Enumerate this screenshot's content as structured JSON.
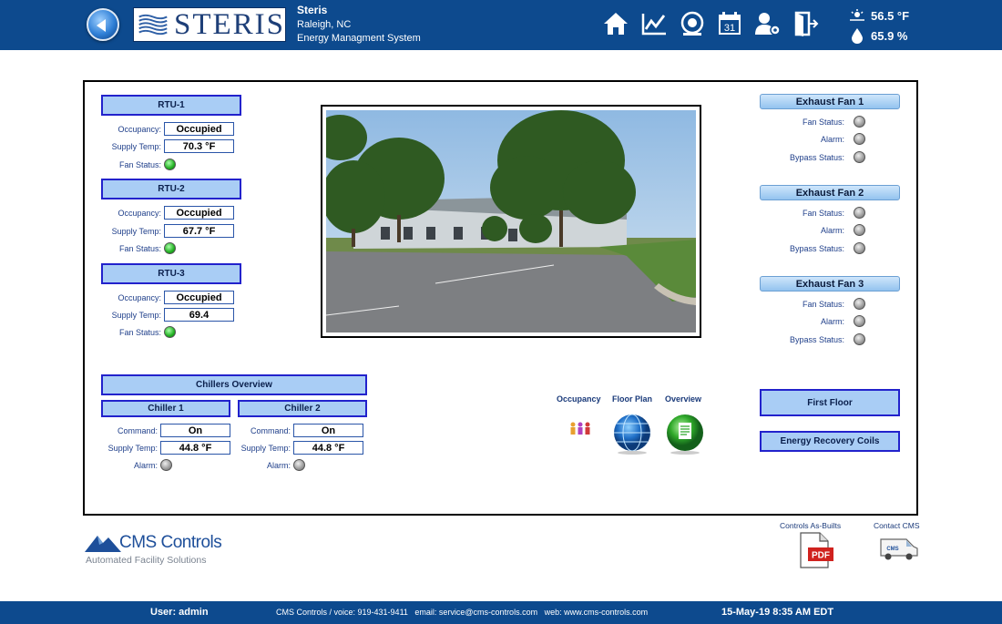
{
  "header": {
    "logo_text": "STERIS",
    "site_name": "Steris",
    "site_location": "Raleigh, NC",
    "site_system": "Energy Managment System",
    "nav_icons": [
      "home-icon",
      "trend-chart-icon",
      "alarm-bell-icon",
      "calendar-icon",
      "user-settings-icon",
      "logout-icon"
    ],
    "calendar_day": "31",
    "outdoor_temp": "56.5 °F",
    "outdoor_humidity": "65.9 %"
  },
  "rtus": [
    {
      "title": "RTU-1",
      "occupancy_label": "Occupancy:",
      "occupancy": "Occupied",
      "supply_label": "Supply Temp:",
      "supply_temp": "70.3 °F",
      "fan_label": "Fan Status:",
      "fan_status": "on"
    },
    {
      "title": "RTU-2",
      "occupancy_label": "Occupancy:",
      "occupancy": "Occupied",
      "supply_label": "Supply Temp:",
      "supply_temp": "67.7 °F",
      "fan_label": "Fan Status:",
      "fan_status": "on"
    },
    {
      "title": "RTU-3",
      "occupancy_label": "Occupancy:",
      "occupancy": "Occupied",
      "supply_label": "Supply Temp:",
      "supply_temp": "69.4",
      "fan_label": "Fan Status:",
      "fan_status": "on"
    }
  ],
  "exhaust_fans": [
    {
      "title": "Exhaust Fan 1",
      "fan_status_label": "Fan Status:",
      "alarm_label": "Alarm:",
      "bypass_label": "Bypass Status:"
    },
    {
      "title": "Exhaust Fan 2",
      "fan_status_label": "Fan Status:",
      "alarm_label": "Alarm:",
      "bypass_label": "Bypass Status:"
    },
    {
      "title": "Exhaust Fan 3",
      "fan_status_label": "Fan Status:",
      "alarm_label": "Alarm:",
      "bypass_label": "Bypass Status:"
    }
  ],
  "chillers": {
    "overview_title": "Chillers Overview",
    "units": [
      {
        "title": "Chiller 1",
        "command_label": "Command:",
        "command": "On",
        "supply_label": "Supply Temp:",
        "supply_temp": "44.8 °F",
        "alarm_label": "Alarm:"
      },
      {
        "title": "Chiller 2",
        "command_label": "Command:",
        "command": "On",
        "supply_label": "Supply Temp:",
        "supply_temp": "44.8 °F",
        "alarm_label": "Alarm:"
      }
    ]
  },
  "quick_links": {
    "occupancy": "Occupancy",
    "floor_plan": "Floor Plan",
    "overview": "Overview"
  },
  "buttons": {
    "first_floor": "First Floor",
    "energy_recovery": "Energy Recovery Coils"
  },
  "bottom": {
    "cms_brand": "CMS Controls",
    "cms_tagline": "Automated Facility Solutions",
    "as_builts_label": "Controls As-Builts",
    "pdf_text": "PDF",
    "contact_label": "Contact CMS",
    "van_text": "CMS"
  },
  "footer": {
    "user": "User: admin",
    "contact": "CMS Controls / voice: 919-431-9411   email: service@cms-controls.com   web: www.cms-controls.com",
    "datetime": "15-May-19 8:35 AM EDT"
  },
  "colors": {
    "bar": "#0d4a8e",
    "header_fill": "#a9cdf5",
    "header_border": "#2222cc",
    "led_on": "#22b022",
    "led_off": "#9a9a9a"
  }
}
